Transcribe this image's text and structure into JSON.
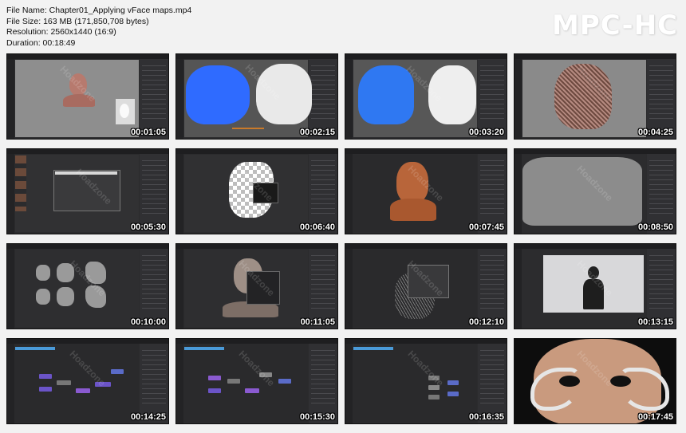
{
  "header": {
    "file_name": "File Name: Chapter01_Applying vFace maps.mp4",
    "file_size": "File Size: 163 MB (171,850,708 bytes)",
    "resolution": "Resolution: 2560x1440 (16:9)",
    "duration": "Duration: 00:18:49"
  },
  "brand": "MPC-HC",
  "watermark": "Hoadzone",
  "thumbnails": [
    {
      "time": "00:01:05",
      "scene": "gray-head-sculpt"
    },
    {
      "time": "00:02:15",
      "scene": "blue-and-white-face"
    },
    {
      "time": "00:03:20",
      "scene": "blue-and-white-face-2"
    },
    {
      "time": "00:04:25",
      "scene": "displacement-head"
    },
    {
      "time": "00:05:30",
      "scene": "dark-dialog"
    },
    {
      "time": "00:06:40",
      "scene": "checker-uv-head"
    },
    {
      "time": "00:07:45",
      "scene": "orange-head"
    },
    {
      "time": "00:08:50",
      "scene": "gray-uv-silhouette"
    },
    {
      "time": "00:10:00",
      "scene": "uv-islands"
    },
    {
      "time": "00:11:05",
      "scene": "head-with-dialog"
    },
    {
      "time": "00:12:10",
      "scene": "wire-head-dialog"
    },
    {
      "time": "00:13:15",
      "scene": "black-figure-light"
    },
    {
      "time": "00:14:25",
      "scene": "node-graph"
    },
    {
      "time": "00:15:30",
      "scene": "node-graph-2"
    },
    {
      "time": "00:16:35",
      "scene": "node-graph-3"
    },
    {
      "time": "00:17:45",
      "scene": "face-closeup"
    }
  ]
}
